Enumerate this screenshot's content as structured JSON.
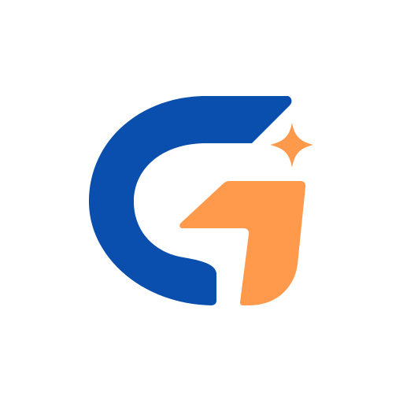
{
  "logo": {
    "colors": {
      "background": "#ffffff",
      "primary_blue": "#0a4fad",
      "accent_orange": "#ff9a4d"
    },
    "elements": [
      {
        "name": "letter-g-blue-arc",
        "color_key": "primary_blue"
      },
      {
        "name": "orange-flag-shape",
        "color_key": "accent_orange"
      },
      {
        "name": "sparkle-star-icon",
        "color_key": "accent_orange"
      }
    ]
  }
}
